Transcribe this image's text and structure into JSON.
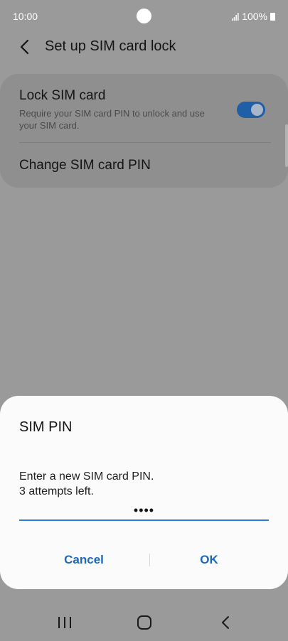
{
  "status_bar": {
    "time": "10:00",
    "battery": "100%"
  },
  "header": {
    "title": "Set up SIM card lock",
    "back_icon": "chevron-left-icon"
  },
  "settings": {
    "lock_sim": {
      "title": "Lock SIM card",
      "subtitle": "Require your SIM card PIN to unlock and use your SIM card.",
      "toggle_on": true,
      "accent_color": "#1f5fa8"
    },
    "change_pin": {
      "title": "Change SIM card PIN"
    }
  },
  "dialog": {
    "title": "SIM PIN",
    "message_line1": "Enter a new SIM card PIN.",
    "message_line2": "3 attempts left.",
    "pin_value": "••••",
    "cancel_label": "Cancel",
    "ok_label": "OK",
    "button_color": "#1e68b8"
  },
  "nav": {
    "recent_icon": "recent-apps-icon",
    "home_icon": "home-icon",
    "back_icon": "back-icon"
  }
}
